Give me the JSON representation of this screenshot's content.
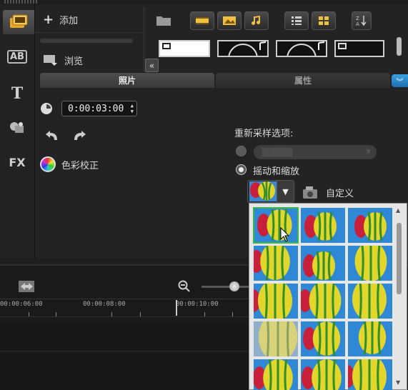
{
  "library": {
    "add_label": "添加",
    "browse_label": "浏览",
    "tabs": [
      {
        "label": "照片",
        "active": true
      },
      {
        "label": "属性",
        "active": false
      }
    ]
  },
  "left_toolbar": {
    "items": [
      {
        "icon": "media-icon",
        "text": ""
      },
      {
        "icon": "transition-icon",
        "text": "AB"
      },
      {
        "icon": "title-icon",
        "text": "T"
      },
      {
        "icon": "graphic-icon",
        "text": ""
      },
      {
        "icon": "filter-icon",
        "text": "FX"
      }
    ]
  },
  "photo_options": {
    "duration": "0:00:03:00",
    "color_correction_label": "色彩校正",
    "resample_label": "重新采样选项:",
    "pan_zoom_label": "摇动和缩放",
    "custom_label": "自定义"
  },
  "timeline": {
    "ticks": [
      "00:00:06:00",
      "00:00:08:00",
      "00:00:10:00"
    ]
  },
  "colors": {
    "accent_blue": "#1c6fb0",
    "selection_green": "#3ab54a",
    "panel_bg": "#232323"
  }
}
